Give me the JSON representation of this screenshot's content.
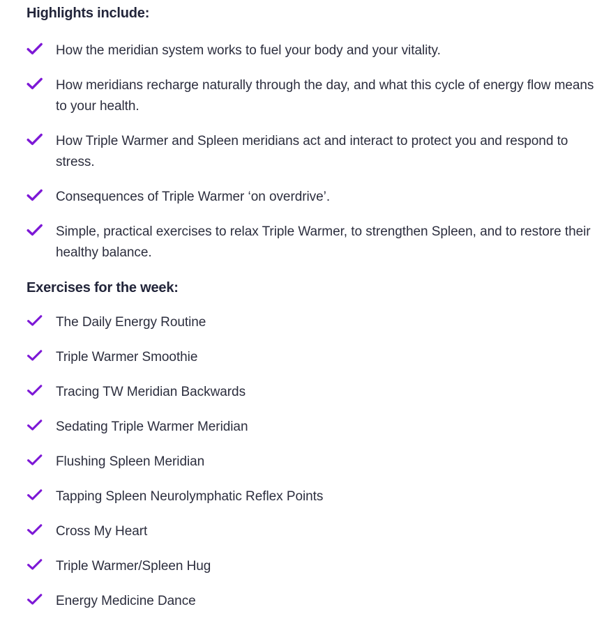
{
  "colors": {
    "accent_check": "#7d18d6",
    "heading_text": "#22253a",
    "body_text": "#2c2e3e",
    "background": "#ffffff"
  },
  "icons": {
    "check": "check-icon"
  },
  "highlights": {
    "heading": "Highlights include:",
    "items": [
      "How the meridian system works to fuel your body and your vitality.",
      "How meridians recharge naturally through the day, and what this cycle of energy flow means to your health.",
      "How Triple Warmer and Spleen meridians act and interact to protect you and respond to stress.",
      "Consequences of Triple Warmer ‘on overdrive’.",
      "Simple, practical exercises to relax Triple Warmer, to strengthen Spleen, and to restore their healthy balance."
    ]
  },
  "exercises": {
    "heading": "Exercises for the week:",
    "items": [
      "The Daily Energy Routine",
      "Triple Warmer Smoothie",
      "Tracing TW Meridian Backwards",
      "Sedating Triple Warmer Meridian",
      "Flushing Spleen Meridian",
      "Tapping Spleen Neurolymphatic Reflex Points",
      "Cross My Heart",
      "Triple Warmer/Spleen Hug",
      "Energy Medicine Dance"
    ]
  }
}
